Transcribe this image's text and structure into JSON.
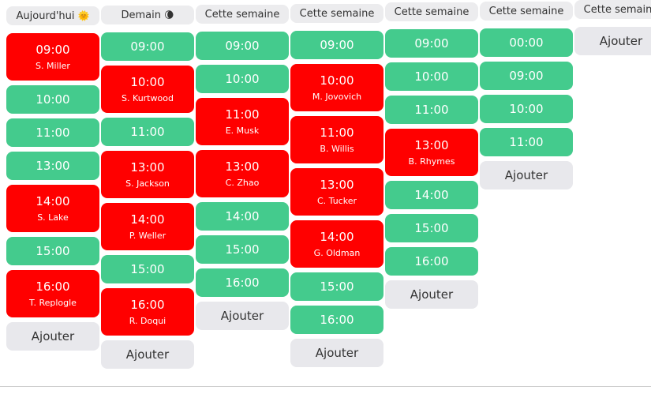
{
  "add_label": "Ajouter",
  "colors": {
    "free": "#44cb8d",
    "booked": "#ff0000",
    "header": "#ececee"
  },
  "columns": [
    {
      "header": "Aujourd'hui",
      "icon": "sun-icon",
      "icon_glyph": "🌞",
      "slots": [
        {
          "time": "09:00",
          "name": "S. Miller"
        },
        {
          "time": "10:00"
        },
        {
          "time": "11:00"
        },
        {
          "time": "13:00"
        },
        {
          "time": "14:00",
          "name": "S. Lake"
        },
        {
          "time": "15:00"
        },
        {
          "time": "16:00",
          "name": "T. Replogle"
        }
      ]
    },
    {
      "header": "Demain",
      "icon": "moon-icon",
      "icon_glyph": "🌘",
      "slots": [
        {
          "time": "09:00"
        },
        {
          "time": "10:00",
          "name": "S. Kurtwood"
        },
        {
          "time": "11:00"
        },
        {
          "time": "13:00",
          "name": "S. Jackson"
        },
        {
          "time": "14:00",
          "name": "P. Weller"
        },
        {
          "time": "15:00"
        },
        {
          "time": "16:00",
          "name": "R. Doqui"
        }
      ]
    },
    {
      "header": "Cette semaine",
      "slots": [
        {
          "time": "09:00"
        },
        {
          "time": "10:00"
        },
        {
          "time": "11:00",
          "name": "E. Musk"
        },
        {
          "time": "13:00",
          "name": "C. Zhao"
        },
        {
          "time": "14:00"
        },
        {
          "time": "15:00"
        },
        {
          "time": "16:00"
        }
      ]
    },
    {
      "header": "Cette semaine",
      "slots": [
        {
          "time": "09:00"
        },
        {
          "time": "10:00",
          "name": "M. Jovovich"
        },
        {
          "time": "11:00",
          "name": "B. Willis"
        },
        {
          "time": "13:00",
          "name": "C. Tucker"
        },
        {
          "time": "14:00",
          "name": "G. Oldman"
        },
        {
          "time": "15:00"
        },
        {
          "time": "16:00"
        }
      ]
    },
    {
      "header": "Cette semaine",
      "slots": [
        {
          "time": "09:00"
        },
        {
          "time": "10:00"
        },
        {
          "time": "11:00"
        },
        {
          "time": "13:00",
          "name": "B. Rhymes"
        },
        {
          "time": "14:00"
        },
        {
          "time": "15:00"
        },
        {
          "time": "16:00"
        }
      ]
    },
    {
      "header": "Cette semaine",
      "slots": [
        {
          "time": "00:00"
        },
        {
          "time": "09:00"
        },
        {
          "time": "10:00"
        },
        {
          "time": "11:00"
        }
      ]
    },
    {
      "header": "Cette semaine",
      "slots": []
    }
  ]
}
